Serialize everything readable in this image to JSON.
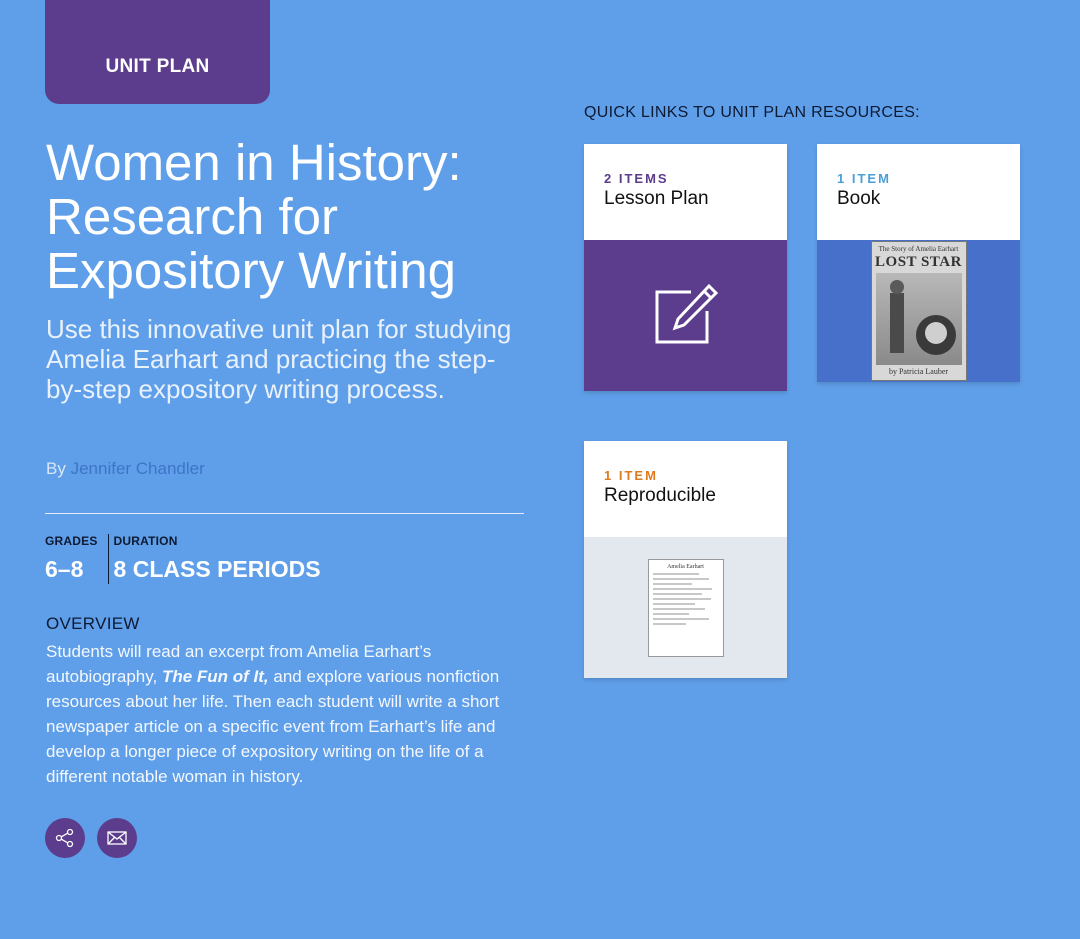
{
  "badge": "UNIT PLAN",
  "title": "Women in History: Research for Expository Writing",
  "subtitle": "Use this innovative unit plan for studying Amelia Earhart and practicing the step-by-step expository writing process.",
  "byline": {
    "prefix": "By",
    "author": "Jennifer Chandler"
  },
  "meta": {
    "grades_label": "GRADES",
    "grades_value": "6–8",
    "duration_label": "DURATION",
    "duration_value": "8 CLASS PERIODS"
  },
  "overview": {
    "heading": "OVERVIEW",
    "text_before": "Students will read an excerpt from Amelia Earhart’s autobiography, ",
    "book_title": "The Fun of It,",
    "text_after": " and explore various nonfiction resources about her life. Then each student will write a short newspaper article on a specific event from Earhart’s life and develop a longer piece of expository writing on the life of a different notable woman in history."
  },
  "actions": {
    "share_icon": "share-icon",
    "email_icon": "mail-icon"
  },
  "quick_links": {
    "heading": "QUICK LINKS TO UNIT PLAN RESOURCES:",
    "cards": [
      {
        "count": "2 ITEMS",
        "label": "Lesson Plan",
        "count_color": "#5c3c8d",
        "image_bg": "#5c3c8d",
        "icon": "edit-icon"
      },
      {
        "count": "1 ITEM",
        "label": "Book",
        "count_color": "#4a9fd6",
        "image_bg": "#4670c9",
        "icon": "book-cover",
        "book": {
          "top": "The Story of Amelia Earhart",
          "title": "LOST STAR",
          "author": "by Patricia Lauber"
        }
      },
      {
        "count": "1 ITEM",
        "label": "Reproducible",
        "count_color": "#e07a1f",
        "image_bg": "#e3e8ee",
        "icon": "worksheet",
        "sheet_title": "Amelia Earhart"
      }
    ]
  },
  "colors": {
    "background": "#5f9fe9",
    "accent": "#5c3c8d",
    "dark_text": "#0d1a33"
  }
}
